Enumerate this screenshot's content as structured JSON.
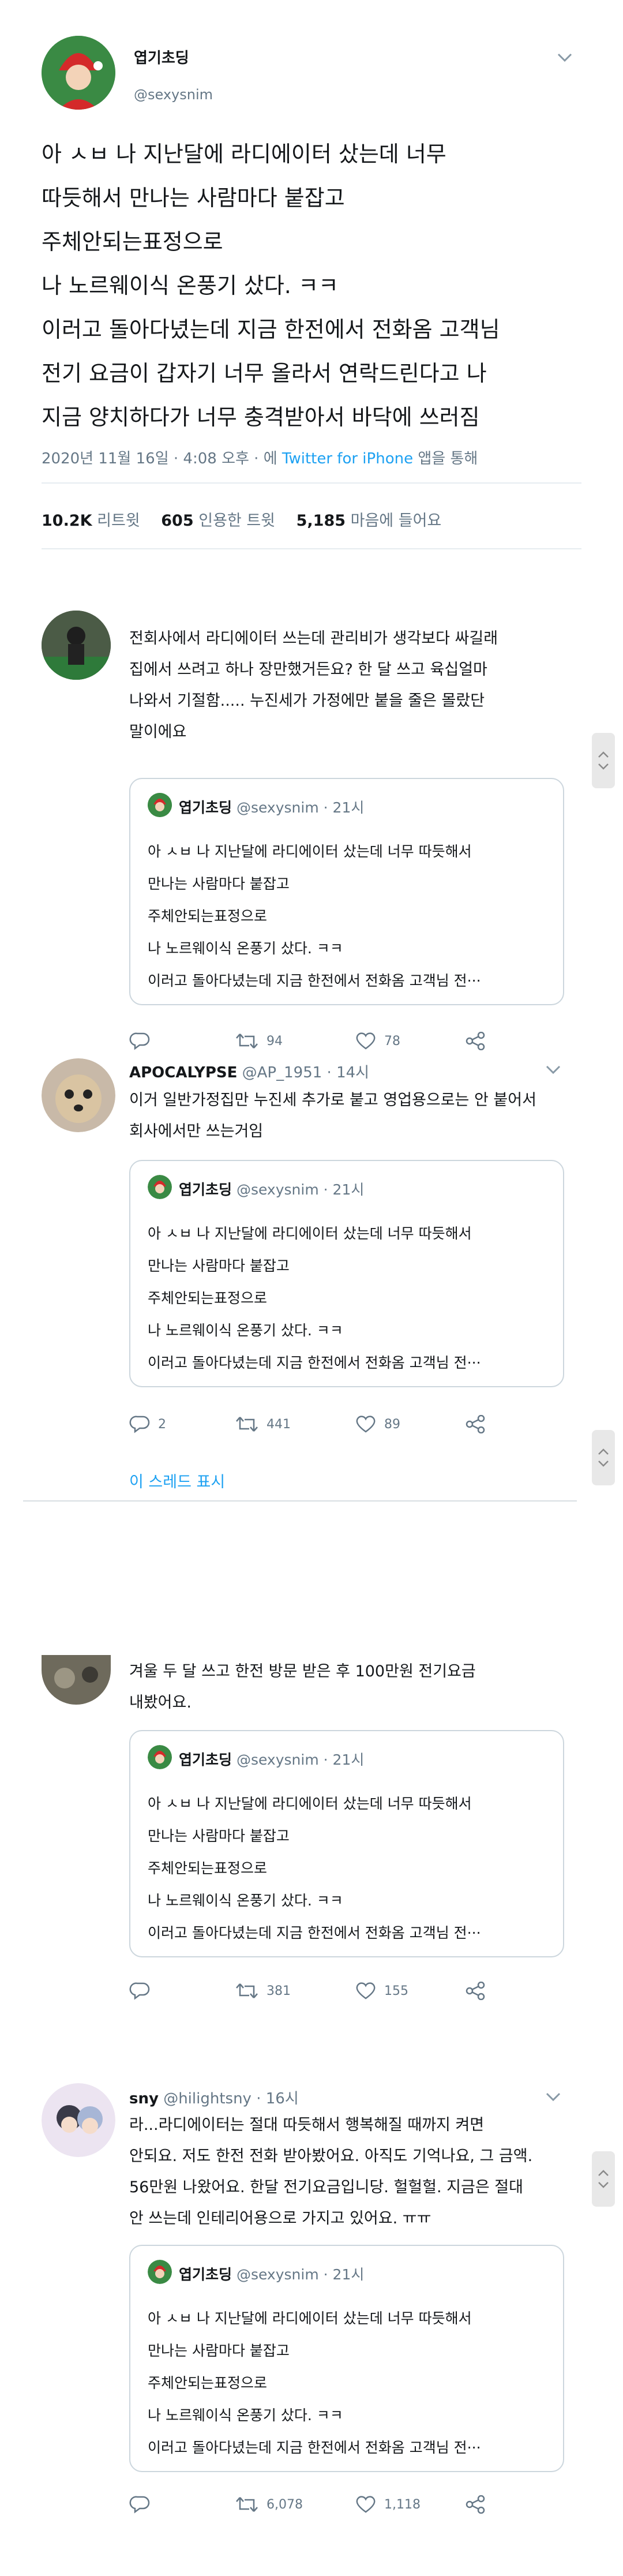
{
  "main_tweet": {
    "name": "엽기초딩",
    "handle": "@sexysnim",
    "lines": [
      "아 ㅅㅂ 나 지난달에 라디에이터 샀는데 너무",
      "따듯해서 만나는 사람마다 붙잡고",
      "주체안되는표정으로",
      "나 노르웨이식 온풍기 샀다. ㅋㅋ",
      "이러고 돌아다녔는데 지금 한전에서 전화옴 고객님",
      "전기 요금이 갑자기 너무 올라서 연락드린다고 나",
      "지금 양치하다가 너무 충격받아서 바닥에 쓰러짐"
    ],
    "meta_date": "2020년 11월 16일 · 4:08 오후 · 에 ",
    "meta_source": "Twitter for iPhone",
    "meta_suffix": " 앱을 통해",
    "retweets": "10.2K",
    "retweets_label": "리트윗",
    "quotes": "605",
    "quotes_label": "인용한 트윗",
    "likes": "5,185",
    "likes_label": "마음에 들어요"
  },
  "quoted": {
    "name": "엽기초딩",
    "handle": "@sexysnim · 21시",
    "lines": [
      "아 ㅅㅂ 나 지난달에 라디에이터 샀는데 너무 따듯해서",
      "만나는 사람마다 붙잡고",
      "주체안되는표정으로",
      "나 노르웨이식 온풍기 샀다. ㅋㅋ",
      "이러고 돌아다녔는데 지금 한전에서 전화옴 고객님 전···"
    ]
  },
  "replies": [
    {
      "lines": [
        "전회사에서 라디에이터 쓰는데 관리비가 생각보다 싸길래",
        "집에서 쓰려고 하나 장만했거든요? 한 달 쓰고 육십얼마",
        "나와서 기절함..... 누진세가 가정에만 붙을 줄은 몰랐단",
        "말이에요"
      ],
      "reply_count": "",
      "retweet_count": "94",
      "like_count": "78"
    },
    {
      "name": "APOCALYPSE",
      "handle": "@AP_1951 · 14시",
      "lines": [
        "이거 일반가정집만 누진세 추가로 붙고 영업용으로는 안 붙어서",
        "회사에서만 쓰는거임"
      ],
      "reply_count": "2",
      "retweet_count": "441",
      "like_count": "89",
      "show_thread": "이 스레드 표시"
    },
    {
      "lines": [
        "겨울 두 달 쓰고 한전 방문 받은 후 100만원 전기요금",
        "내봤어요."
      ],
      "reply_count": "",
      "retweet_count": "381",
      "like_count": "155"
    },
    {
      "name": "sny",
      "handle": "@hilightsny · 16시",
      "lines": [
        "라...라디에이터는 절대 따듯해서 행복해질 때까지 켜면",
        "안되요. 저도 한전 전화 받아봤어요. 아직도 기억나요, 그 금액.",
        "56만원 나왔어요. 한달 전기요금입니당. 헐헐헐. 지금은 절대",
        "안 쓰는데 인테리어용으로 가지고 있어요. ㅠㅠ"
      ],
      "reply_count": "",
      "retweet_count": "6,078",
      "like_count": "1,118"
    }
  ]
}
